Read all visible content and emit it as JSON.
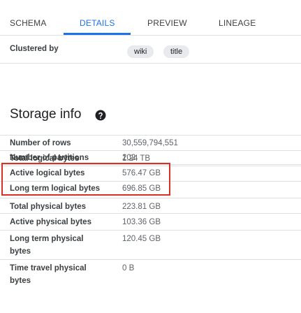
{
  "tabs": [
    "SCHEMA",
    "DETAILS",
    "PREVIEW",
    "LINEAGE"
  ],
  "active_tab": "DETAILS",
  "clustered": {
    "label": "Clustered by",
    "chips": [
      "wiki",
      "title"
    ]
  },
  "storage": {
    "title": "Storage info",
    "help_icon": "help-icon",
    "rows": [
      {
        "label": "Number of rows",
        "value": "30,559,794,551"
      },
      {
        "label": "Number of partitions",
        "value": "202"
      },
      {
        "label": "Total logical bytes",
        "value": "1.24 TB"
      },
      {
        "label": "Active logical bytes",
        "value": "576.47 GB"
      },
      {
        "label": "Long term logical bytes",
        "value": "696.85 GB"
      },
      {
        "label": "Total physical bytes",
        "value": "223.81 GB"
      },
      {
        "label": "Active physical bytes",
        "value": "103.36 GB"
      },
      {
        "label": "Long term physical bytes",
        "value": "120.45 GB"
      },
      {
        "label": "Time travel physical bytes",
        "value": "0 B"
      }
    ]
  },
  "colors": {
    "accent": "#1a73e8",
    "highlight": "#d93025"
  }
}
